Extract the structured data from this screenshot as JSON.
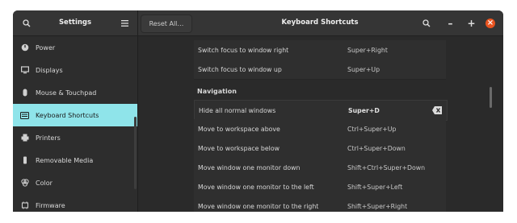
{
  "sidebar_header": {
    "title": "Settings"
  },
  "header": {
    "title": "Keyboard Shortcuts",
    "reset_label": "Reset All…"
  },
  "window_controls": {
    "minimize": "–",
    "maximize": "+",
    "close": "×"
  },
  "sidebar": {
    "items": [
      {
        "label": "Power",
        "icon": "power-icon"
      },
      {
        "label": "Displays",
        "icon": "display-icon"
      },
      {
        "label": "Mouse & Touchpad",
        "icon": "mouse-icon"
      },
      {
        "label": "Keyboard Shortcuts",
        "icon": "keyboard-icon",
        "active": true
      },
      {
        "label": "Printers",
        "icon": "printer-icon"
      },
      {
        "label": "Removable Media",
        "icon": "usb-icon"
      },
      {
        "label": "Color",
        "icon": "color-icon"
      },
      {
        "label": "Firmware",
        "icon": "chip-icon"
      }
    ]
  },
  "shortcuts": {
    "top_rows": [
      {
        "name": "Switch focus to window right",
        "shortcut": "Super+Right"
      },
      {
        "name": "Switch focus to window up",
        "shortcut": "Super+Up"
      }
    ],
    "section_title": "Navigation",
    "nav_rows": [
      {
        "name": "Hide all normal windows",
        "shortcut": "Super+D",
        "bold": true
      },
      {
        "name": "Move to workspace above",
        "shortcut": "Ctrl+Super+Up"
      },
      {
        "name": "Move to workspace below",
        "shortcut": "Ctrl+Super+Down"
      },
      {
        "name": "Move window one monitor down",
        "shortcut": "Shift+Ctrl+Super+Down"
      },
      {
        "name": "Move window one monitor to the left",
        "shortcut": "Shift+Super+Left"
      },
      {
        "name": "Move window one monitor to the right",
        "shortcut": "Shift+Super+Right"
      }
    ]
  },
  "colors": {
    "accent": "#8fe4ea",
    "close": "#e95420"
  }
}
